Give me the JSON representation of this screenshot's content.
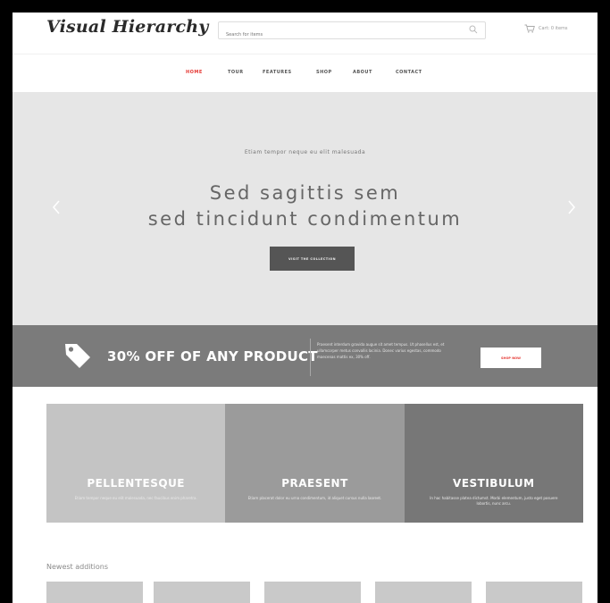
{
  "brand": {
    "logo": "Visual Hierarchy"
  },
  "search": {
    "placeholder": "Search for items"
  },
  "cart": {
    "label": "Cart: 0 items"
  },
  "nav": {
    "items": [
      {
        "label": "HOME",
        "active": true
      },
      {
        "label": "TOUR",
        "active": false
      },
      {
        "label": "FEATURES",
        "active": false
      },
      {
        "label": "SHOP",
        "active": false
      },
      {
        "label": "ABOUT",
        "active": false
      },
      {
        "label": "CONTACT",
        "active": false
      }
    ]
  },
  "hero": {
    "kicker": "Etiam tempor neque eu elit malesuada",
    "title_line1": "Sed sagittis sem",
    "title_line2": "sed tincidunt condimentum",
    "button_label": "VISIT THE COLLECTION"
  },
  "promo": {
    "title": "30% OFF OF ANY PRODUCT",
    "text": "Praesent interdum gravida augue sit amet tempus. Ut phasellus est, et ullamcorper metus convallis lacinia. Donec varius egestas, commodo maecenas mattis ex, 30% off.",
    "button_label": "SHOP NOW"
  },
  "features": [
    {
      "title": "PELLENTESQUE",
      "desc": "Etiam tempor neque eu elit malesuada, nec faucibus enim pharetra.",
      "color": "#c4c4c4"
    },
    {
      "title": "PRAESENT",
      "desc": "Etiam placerat dolor eu urna condimentum, id aliquet cursus nulla laoreet.",
      "color": "#9b9b9b"
    },
    {
      "title": "VESTIBULUM",
      "desc": "In hac habitasse platea dictumst. Morbi elementum, justo eget posuere lobortis, nunc arcu.",
      "color": "#777777"
    }
  ],
  "newest": {
    "heading": "Newest additions"
  },
  "colors": {
    "accent": "#e53935",
    "hero_bg": "#e6e6e6",
    "promo_bg": "#7b7b7b",
    "button_dark": "#555555"
  },
  "icons": [
    "search-icon",
    "cart-icon",
    "chevron-left-icon",
    "chevron-right-icon",
    "price-tag-icon"
  ]
}
